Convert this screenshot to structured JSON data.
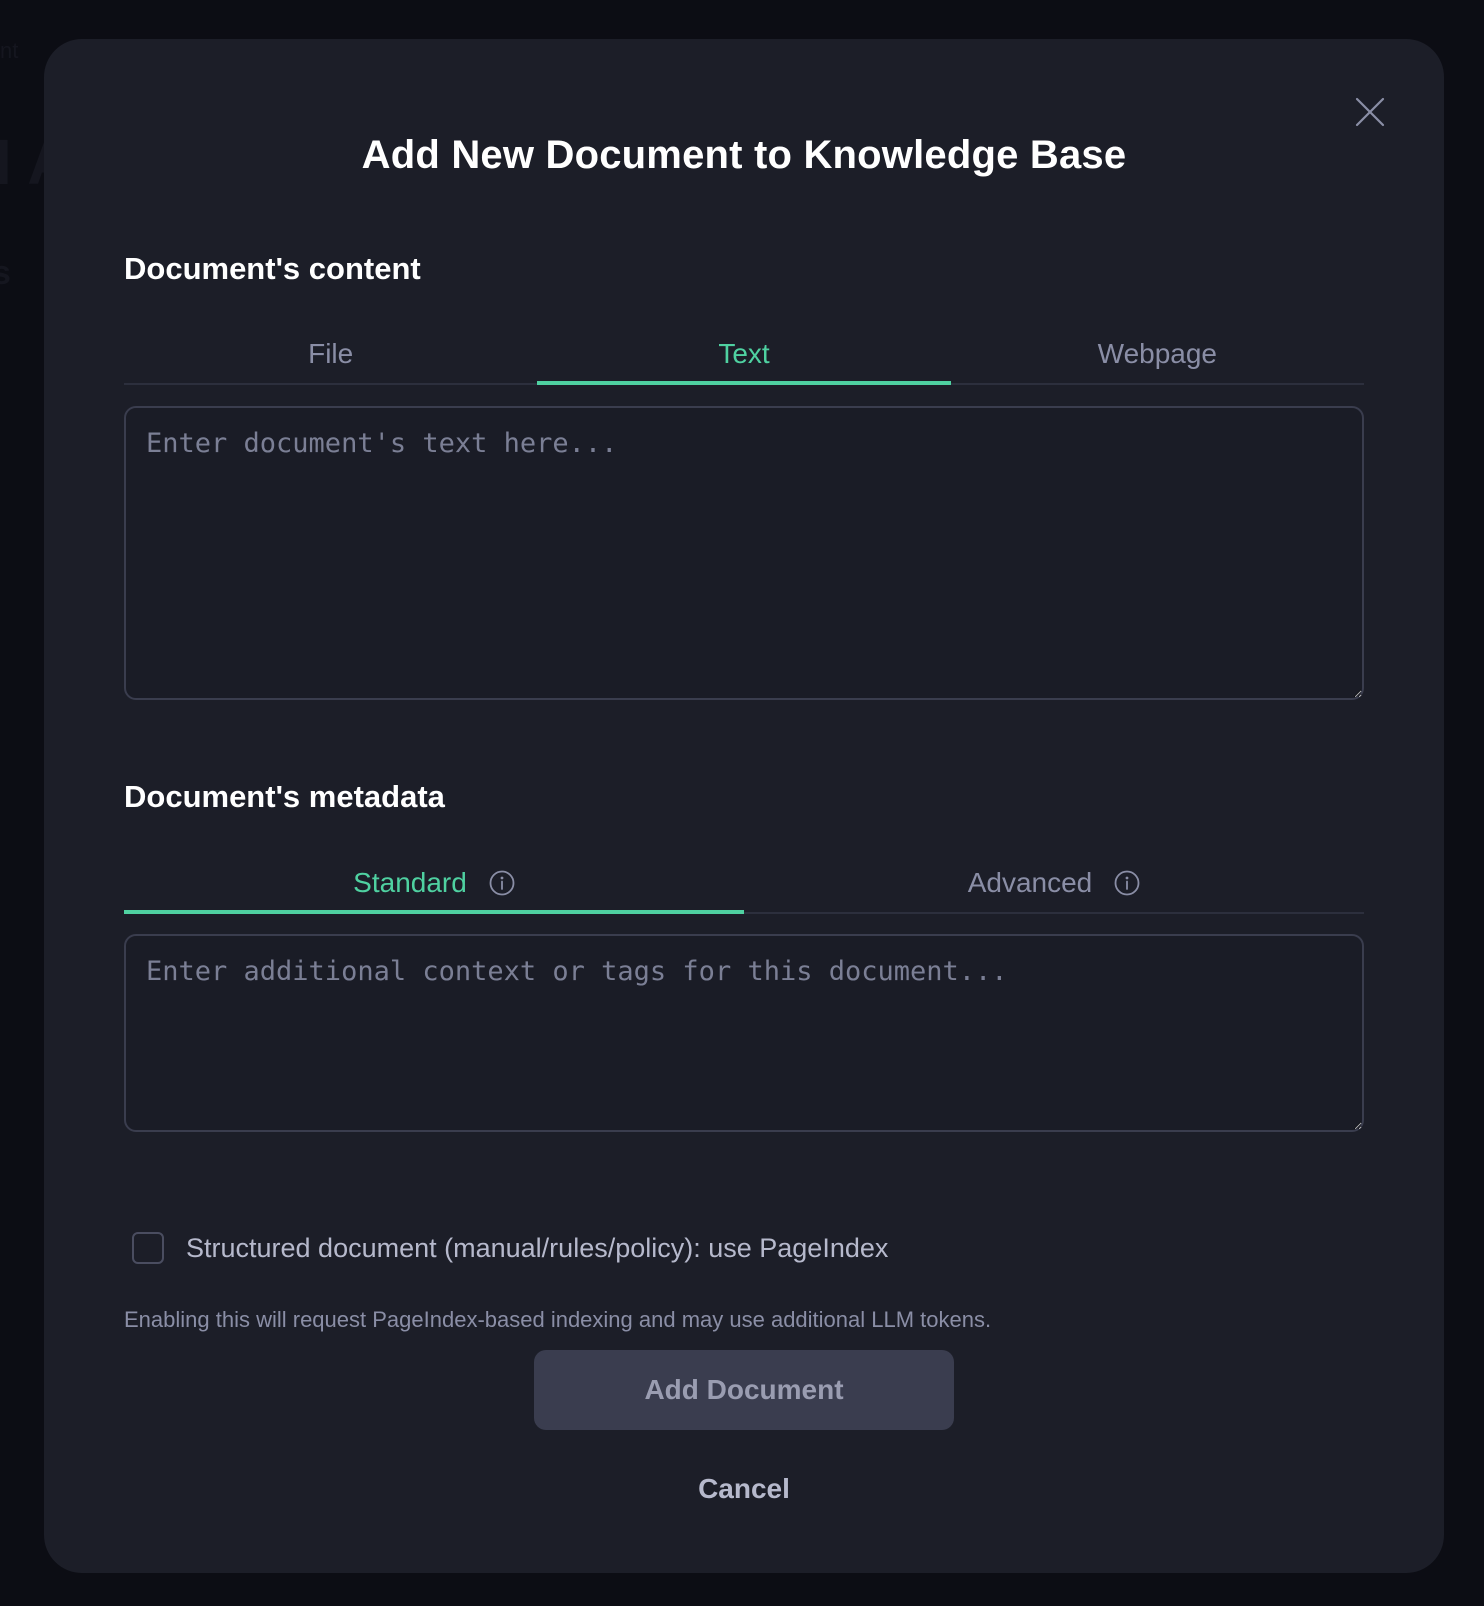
{
  "backdrop": {
    "fragment_small": "nt",
    "fragment_large": "I A",
    "fragment_mid": "s"
  },
  "modal": {
    "title": "Add New Document to Knowledge Base",
    "close_icon": "close-icon",
    "content_section": {
      "heading": "Document's content",
      "tabs": [
        {
          "label": "File",
          "active": false
        },
        {
          "label": "Text",
          "active": true
        },
        {
          "label": "Webpage",
          "active": false
        }
      ],
      "textarea_placeholder": "Enter document's text here...",
      "textarea_value": ""
    },
    "metadata_section": {
      "heading": "Document's metadata",
      "tabs": [
        {
          "label": "Standard",
          "active": true,
          "icon": "info-icon"
        },
        {
          "label": "Advanced",
          "active": false,
          "icon": "info-icon"
        }
      ],
      "textarea_placeholder": "Enter additional context or tags for this document...",
      "textarea_value": ""
    },
    "pageindex_option": {
      "label": "Structured document (manual/rules/policy): use PageIndex",
      "checked": false,
      "help": "Enabling this will request PageIndex-based indexing and may use additional LLM tokens."
    },
    "primary_button": "Add Document",
    "cancel_button": "Cancel"
  },
  "colors": {
    "accent": "#4fd1a1",
    "modal_bg": "#1c1e28",
    "page_bg": "#0c0d14",
    "muted_text": "#8a8ea6",
    "button_bg": "#3a3d4f"
  }
}
